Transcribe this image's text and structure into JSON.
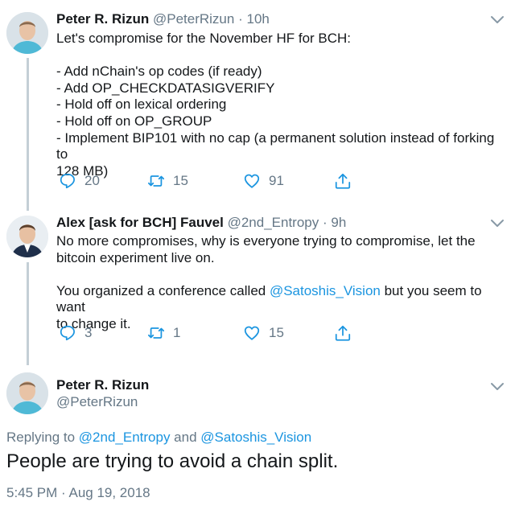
{
  "tweets": [
    {
      "name": "Peter R. Rizun",
      "handle": "@PeterRizun",
      "time": "10h",
      "lines": [
        "Let's compromise for the November HF for BCH:",
        "",
        "- Add nChain's op codes (if ready)",
        "- Add OP_CHECKDATASIGVERIFY",
        "- Hold off on lexical ordering",
        "- Hold off on OP_GROUP",
        "- Implement BIP101 with no cap (a permanent solution instead of forking to",
        "128 MB)"
      ],
      "replies": "20",
      "retweets": "15",
      "likes": "91"
    },
    {
      "name": "Alex [ask for BCH] Fauvel",
      "handle": "@2nd_Entropy",
      "time": "9h",
      "line1": "No more compromises, why is everyone trying to compromise, let the",
      "line2": "bitcoin experiment live on.",
      "line4_before": "You organized a conference called ",
      "line4_mention": "@Satoshis_Vision",
      "line4_after": " but you seem to want",
      "line5": "to change it.",
      "replies": "3",
      "retweets": "1",
      "likes": "15"
    }
  ],
  "main_tweet": {
    "name": "Peter R. Rizun",
    "handle": "@PeterRizun",
    "replying_prefix": "Replying to ",
    "replying_to_1": "@2nd_Entropy",
    "replying_and": " and ",
    "replying_to_2": "@Satoshis_Vision",
    "text": "People are trying to avoid a chain split.",
    "timestamp": "5:45 PM · Aug 19, 2018"
  },
  "separator_dot": "·",
  "colors": {
    "text": "#14171a",
    "secondary": "#657786",
    "link": "#1b95e0",
    "thread_line": "#c4cfd6"
  }
}
